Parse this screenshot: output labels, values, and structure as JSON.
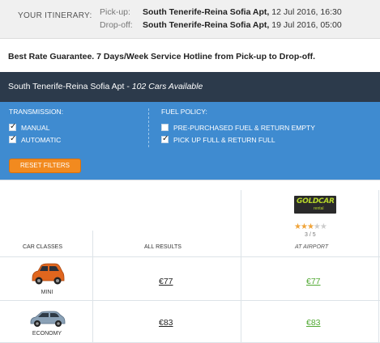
{
  "itinerary": {
    "label": "YOUR ITINERARY:",
    "pickup_key": "Pick-up:",
    "pickup_loc": "South Tenerife-Reina Sofia Apt,",
    "pickup_dt": "12 Jul 2016, 16:30",
    "dropoff_key": "Drop-off:",
    "dropoff_loc": "South Tenerife-Reina Sofia Apt,",
    "dropoff_dt": "19 Jul 2016, 05:00"
  },
  "promo": "Best Rate Guarantee. 7 Days/Week Service Hotline from Pick-up to Drop-off.",
  "results_bar": {
    "location": "South Tenerife-Reina Sofia Apt",
    "sep": " - ",
    "available": "102 Cars Available"
  },
  "filters": {
    "transmission": {
      "title": "TRANSMISSION:",
      "options": [
        {
          "label": "MANUAL",
          "checked": true
        },
        {
          "label": "AUTOMATIC",
          "checked": true
        }
      ]
    },
    "fuel": {
      "title": "FUEL POLICY:",
      "options": [
        {
          "label": "PRE-PURCHASED FUEL & RETURN EMPTY",
          "checked": false
        },
        {
          "label": "PICK UP FULL & RETURN FULL",
          "checked": true
        }
      ]
    },
    "reset_label": "RESET FILTERS"
  },
  "table": {
    "supplier": {
      "logo_text": "GOLDCAR",
      "logo_sub": "rental",
      "stars_filled": 3,
      "stars_total": 5,
      "rating_text": "3 / 5",
      "location": "AT AIRPORT"
    },
    "headers": {
      "car_classes": "CAR CLASSES",
      "all_results": "ALL RESULTS"
    },
    "rows": [
      {
        "class": "MINI",
        "all": "€77",
        "supplier": "€77",
        "car_color": "#e0661e"
      },
      {
        "class": "ECONOMY",
        "all": "€83",
        "supplier": "€83",
        "car_color": "#8aa1b6"
      }
    ]
  }
}
